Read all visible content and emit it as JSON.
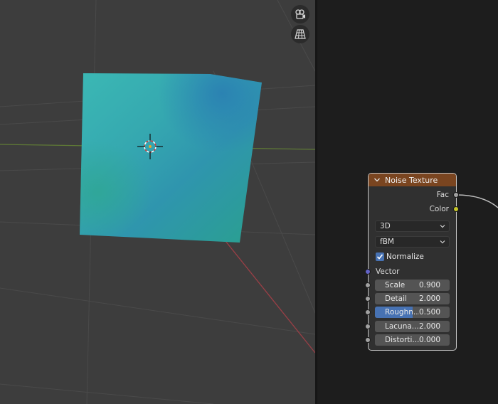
{
  "viewport": {
    "nav_buttons": [
      {
        "name": "camera-view-icon"
      },
      {
        "name": "grid-view-icon"
      }
    ]
  },
  "node": {
    "title": "Noise Texture",
    "header_color": "#7a4520",
    "outputs": [
      {
        "label": "Fac",
        "socket_color": "#a1a1a1"
      },
      {
        "label": "Color",
        "socket_color": "#c7c729"
      }
    ],
    "dimensions": "3D",
    "noise_type": "fBM",
    "normalize": {
      "label": "Normalize",
      "checked": true
    },
    "vector_label": "Vector",
    "inputs": [
      {
        "label": "Scale",
        "value": "0.900",
        "fraction": 0
      },
      {
        "label": "Detail",
        "value": "2.000",
        "fraction": 0
      },
      {
        "label": "Roughn...",
        "value": "0.500",
        "fraction": 0.5
      },
      {
        "label": "Lacuna...",
        "value": "2.000",
        "fraction": 0
      },
      {
        "label": "Distorti...",
        "value": "0.000",
        "fraction": 0
      }
    ]
  }
}
